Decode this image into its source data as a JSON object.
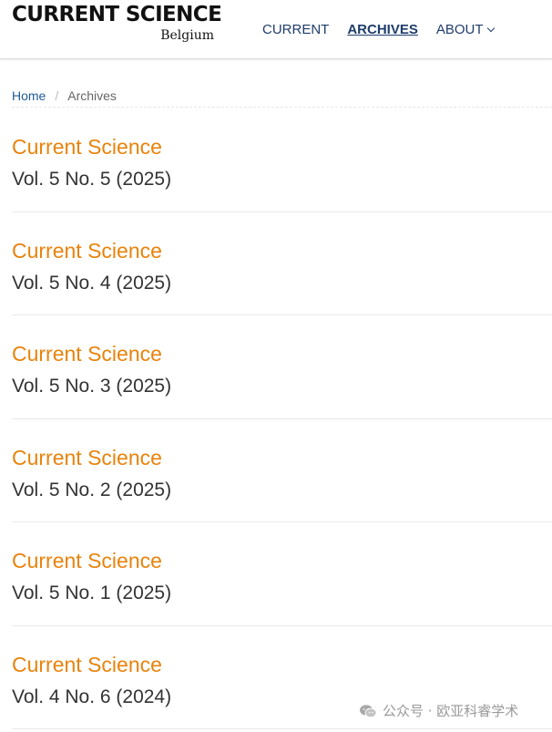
{
  "header": {
    "logo_main": "CURRENT SCIENCE",
    "logo_sub": "Belgium",
    "nav": [
      {
        "label": "CURRENT",
        "active": false
      },
      {
        "label": "ARCHIVES",
        "active": true
      },
      {
        "label": "ABOUT",
        "active": false,
        "icon": "chevron-down-icon"
      }
    ]
  },
  "breadcrumb": {
    "home": "Home",
    "separator": "/",
    "current": "Archives"
  },
  "issues": [
    {
      "title": "Current Science",
      "volume": "Vol. 5 No. 5 (2025)"
    },
    {
      "title": "Current Science",
      "volume": "Vol. 5 No. 4 (2025)"
    },
    {
      "title": "Current Science",
      "volume": "Vol. 5 No. 3 (2025)"
    },
    {
      "title": "Current Science",
      "volume": "Vol. 5 No. 2 (2025)"
    },
    {
      "title": "Current Science",
      "volume": "Vol. 5 No. 1 (2025)"
    },
    {
      "title": "Current Science",
      "volume": "Vol. 4 No. 6 (2024)"
    }
  ],
  "watermark": {
    "icon": "wechat-icon",
    "text": "公众号 · 欧亚科睿学术"
  },
  "colors": {
    "accent": "#e8830c",
    "nav": "#1f3d6b",
    "link": "#1f5a99"
  }
}
